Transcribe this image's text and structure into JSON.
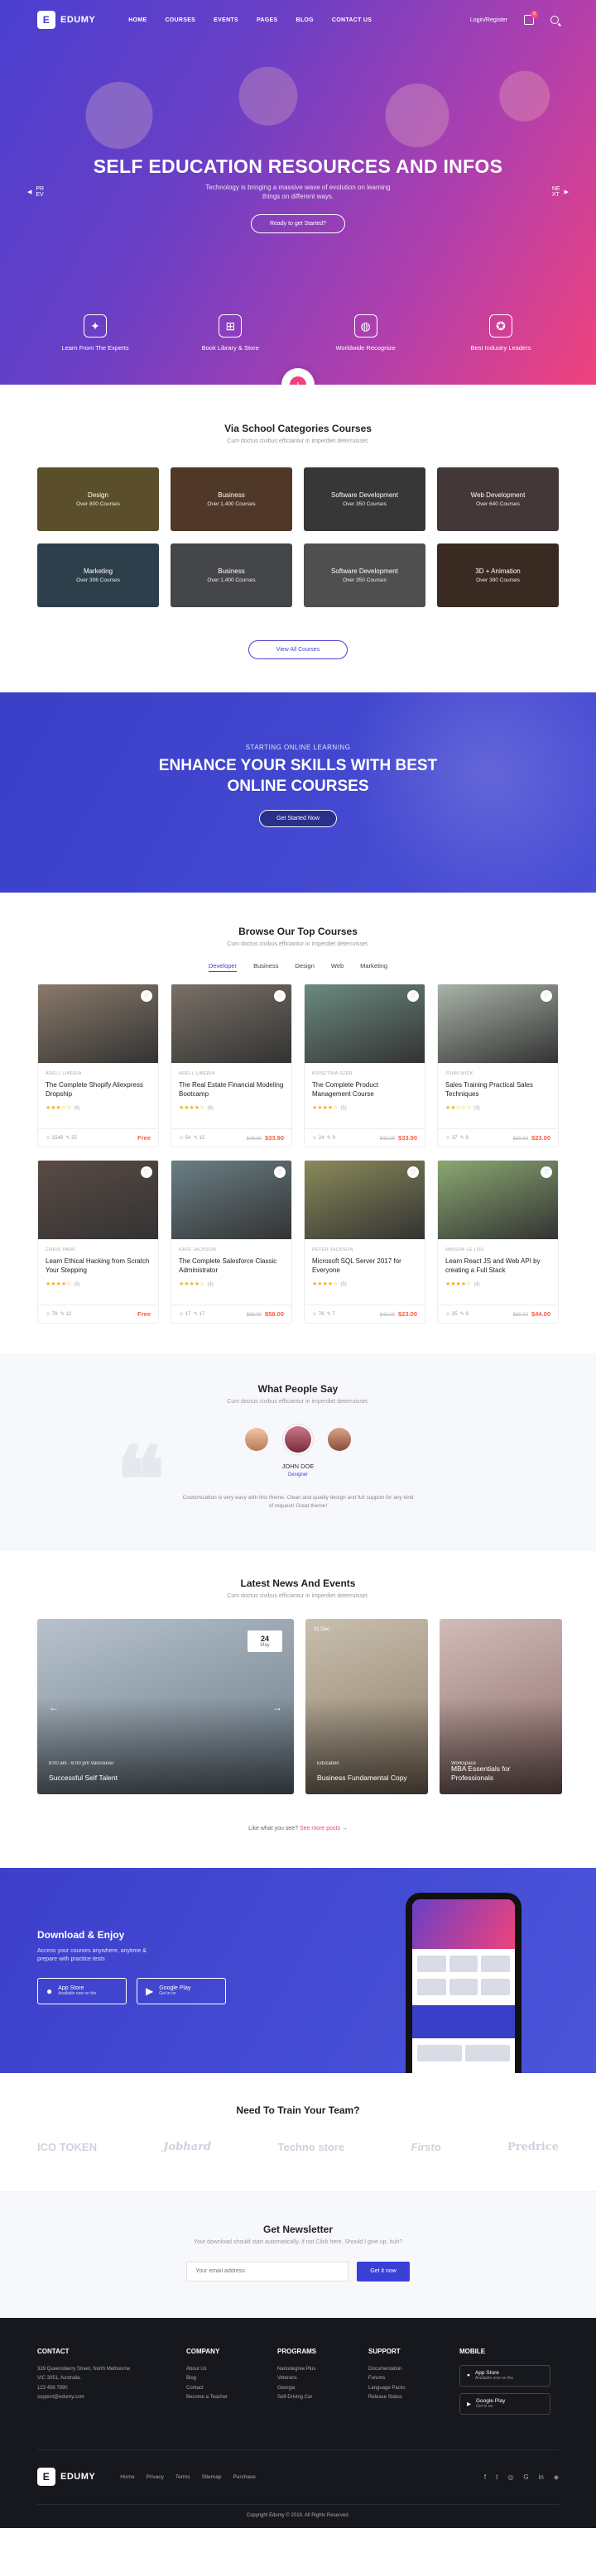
{
  "brand": {
    "name": "EDUMY"
  },
  "nav": {
    "items": [
      "HOME",
      "COURSES",
      "EVENTS",
      "PAGES",
      "BLOG",
      "CONTACT US"
    ],
    "login": "Login/Register",
    "cart_count": "0"
  },
  "hero": {
    "title": "SELF EDUCATION RESOURCES AND INFOS",
    "subtitle_line1": "Technology is bringing a massive wave of evolution on learning",
    "subtitle_line2": "things on different ways.",
    "cta": "Ready to get Started?",
    "prev_label": "PR",
    "prev_sub": "EV",
    "next_label": "NE",
    "next_sub": "XT",
    "features": [
      {
        "icon": "experts-icon",
        "glyph": "✦",
        "label": "Learn From The Experts"
      },
      {
        "icon": "book-icon",
        "glyph": "⊞",
        "label": "Book Library & Store"
      },
      {
        "icon": "globe-icon",
        "glyph": "◍",
        "label": "Worldwide Recognize"
      },
      {
        "icon": "award-icon",
        "glyph": "✪",
        "label": "Best Industry Leaders"
      }
    ]
  },
  "categories": {
    "title": "Via School Categories Courses",
    "subtitle": "Cum doctus civibus efficiantur in imperdiet deterruisset.",
    "items": [
      {
        "name": "Design",
        "count": "Over 800 Courses",
        "color": "#7a6a3a"
      },
      {
        "name": "Business",
        "count": "Over 1,400 Courses",
        "color": "#6b4b36"
      },
      {
        "name": "Software Development",
        "count": "Over 350 Courses",
        "color": "#4a4a4a"
      },
      {
        "name": "Web Development",
        "count": "Over 640 Courses",
        "color": "#5a4a4a"
      },
      {
        "name": "Marketing",
        "count": "Over 306 Courses",
        "color": "#3e5566"
      },
      {
        "name": "Business",
        "count": "Over 1,400 Courses",
        "color": "#5b5e62"
      },
      {
        "name": "Software Development",
        "count": "Over 350 Courses",
        "color": "#6a6a6a"
      },
      {
        "name": "3D + Animation",
        "count": "Over 380 Courses",
        "color": "#4d3a2e"
      }
    ],
    "cta": "View All Courses"
  },
  "enhance": {
    "kicker": "STARTING ONLINE LEARNING",
    "title_line1": "ENHANCE YOUR SKILLS WITH BEST",
    "title_line2": "ONLINE COURSES",
    "cta": "Get Started Now"
  },
  "courses": {
    "title": "Browse Our Top Courses",
    "subtitle": "Cum doctus civibus efficiantur in imperdiet deterruisset.",
    "tabs": [
      "Developer",
      "Business",
      "Design",
      "Web",
      "Marketing"
    ],
    "items": [
      {
        "author": "ARELL LIBERIA",
        "title": "The Complete Shopify Aliexpress Dropship",
        "stars": "★★★☆☆",
        "reviews": "(6)",
        "students": "☺ 1548",
        "comments": "✎ 25",
        "old_price": "",
        "price": "Free",
        "color": "#8a7a6a"
      },
      {
        "author": "ARELL LIBERIA",
        "title": "The Real Estate Financial Modeling Bootcamp",
        "stars": "★★★★☆",
        "reviews": "(8)",
        "students": "☺ 54",
        "comments": "✎ 15",
        "old_price": "$49.00",
        "price": "$33.90",
        "color": "#7a7066"
      },
      {
        "author": "KRISZTINA SZER",
        "title": "The Complete Product Management Course",
        "stars": "★★★★☆",
        "reviews": "(5)",
        "students": "☺ 24",
        "comments": "✎ 9",
        "old_price": "$49.00",
        "price": "$33.90",
        "color": "#6b8a80"
      },
      {
        "author": "JOHN WICK",
        "title": "Sales Training Practical Sales Techniques",
        "stars": "★★☆☆☆",
        "reviews": "(3)",
        "students": "☺ 37",
        "comments": "✎ 9",
        "old_price": "$39.00",
        "price": "$23.00",
        "color": "#a9b3a8"
      },
      {
        "author": "CHRIS PARK",
        "title": "Learn Ethical Hacking from Scratch Your Stepping",
        "stars": "★★★★☆",
        "reviews": "(5)",
        "students": "☺ 79",
        "comments": "✎ 12",
        "old_price": "",
        "price": "Free",
        "color": "#5a4a44"
      },
      {
        "author": "KATE JACKSON",
        "title": "The Complete Salesforce Classic Administrator",
        "stars": "★★★★☆",
        "reviews": "(4)",
        "students": "☺ 17",
        "comments": "✎ 17",
        "old_price": "$89.00",
        "price": "$58.00",
        "color": "#6a7f86"
      },
      {
        "author": "PETER JACKSON",
        "title": "Microsoft SQL Server 2017 for Everyone",
        "stars": "★★★★☆",
        "reviews": "(5)",
        "students": "☺ 78",
        "comments": "✎ 7",
        "old_price": "$49.00",
        "price": "$23.00",
        "color": "#8a8a5a"
      },
      {
        "author": "MAISON LE LOU",
        "title": "Learn React JS and Web API by creating a Full Stack",
        "stars": "★★★★☆",
        "reviews": "(4)",
        "students": "☺ 25",
        "comments": "✎ 9",
        "old_price": "$39.00",
        "price": "$44.00",
        "color": "#8aa870"
      }
    ]
  },
  "testimonials": {
    "title": "What People Say",
    "subtitle": "Cum doctus civibus efficiantur in imperdiet deterruisset.",
    "name": "JOHN DOE",
    "role": "Designer",
    "quote": "Customization is very easy with this theme. Clean and quality design and full support for any kind of request! Great theme!"
  },
  "news": {
    "title": "Latest News And Events",
    "subtitle": "Cum doctus civibus efficiantur in imperdiet deterruisset.",
    "items": [
      {
        "date_day": "24",
        "date_month": "May",
        "tag": "",
        "meta": "8:00 am - 6:00 pm   Vancouver",
        "title": "Successful Self Talent",
        "color": "#7a8a96"
      },
      {
        "date_day": "",
        "date_month": "",
        "tag": "31 Dec",
        "meta": "Education",
        "title": "Business Fundamental Copy",
        "color": "#a09a8a"
      },
      {
        "date_day": "",
        "date_month": "",
        "tag": "",
        "meta": "Workspace",
        "title": "MBA Essentials for Professionals",
        "color": "#9a8a88"
      }
    ],
    "more_text": "Like what you see?",
    "more_link": "See more posts"
  },
  "app": {
    "title": "Download & Enjoy",
    "text": "Access your courses anywhere, anytime & prepare with practice tests",
    "app_store": "App Store",
    "app_store_sub": "Available now on the",
    "google_play": "Google Play",
    "google_play_sub": "Get in on"
  },
  "partners": {
    "title": "Need To Train Your Team?",
    "logos": [
      "ICO TOKEN",
      "Jobhard",
      "Techno store",
      "Firsto",
      "Predrice"
    ]
  },
  "newsletter": {
    "title": "Get Newsletter",
    "subtitle": "Your download should start automatically, if not Click here. Should I give up, huh?",
    "placeholder": "Your email address",
    "button": "Get it now"
  },
  "footer": {
    "contact_title": "CONTACT",
    "contact_lines": [
      "329 Queensberry Street, North Melbourne",
      "VIC 3051, Australia.",
      "123 456 7890",
      "support@edumy.com"
    ],
    "company_title": "COMPANY",
    "company_items": [
      "About Us",
      "Blog",
      "Contact",
      "Become a Teacher"
    ],
    "programs_title": "PROGRAMS",
    "programs_items": [
      "Nanodegree Plus",
      "Veterans",
      "Georgia",
      "Self-Driving Car"
    ],
    "support_title": "SUPPORT",
    "support_items": [
      "Documentation",
      "Forums",
      "Language Packs",
      "Release Status"
    ],
    "mobile_title": "MOBILE",
    "app_store": "App Store",
    "app_store_sub": "Available now on the",
    "google_play": "Google Play",
    "google_play_sub": "Get in on",
    "bottom_links": [
      "Home",
      "Privacy",
      "Terms",
      "Sitemap",
      "Purchase"
    ],
    "social": [
      "f",
      "t",
      "◎",
      "G",
      "in",
      "◈"
    ],
    "copyright": "Copyright Edumy © 2019. All Rights Reserved."
  }
}
